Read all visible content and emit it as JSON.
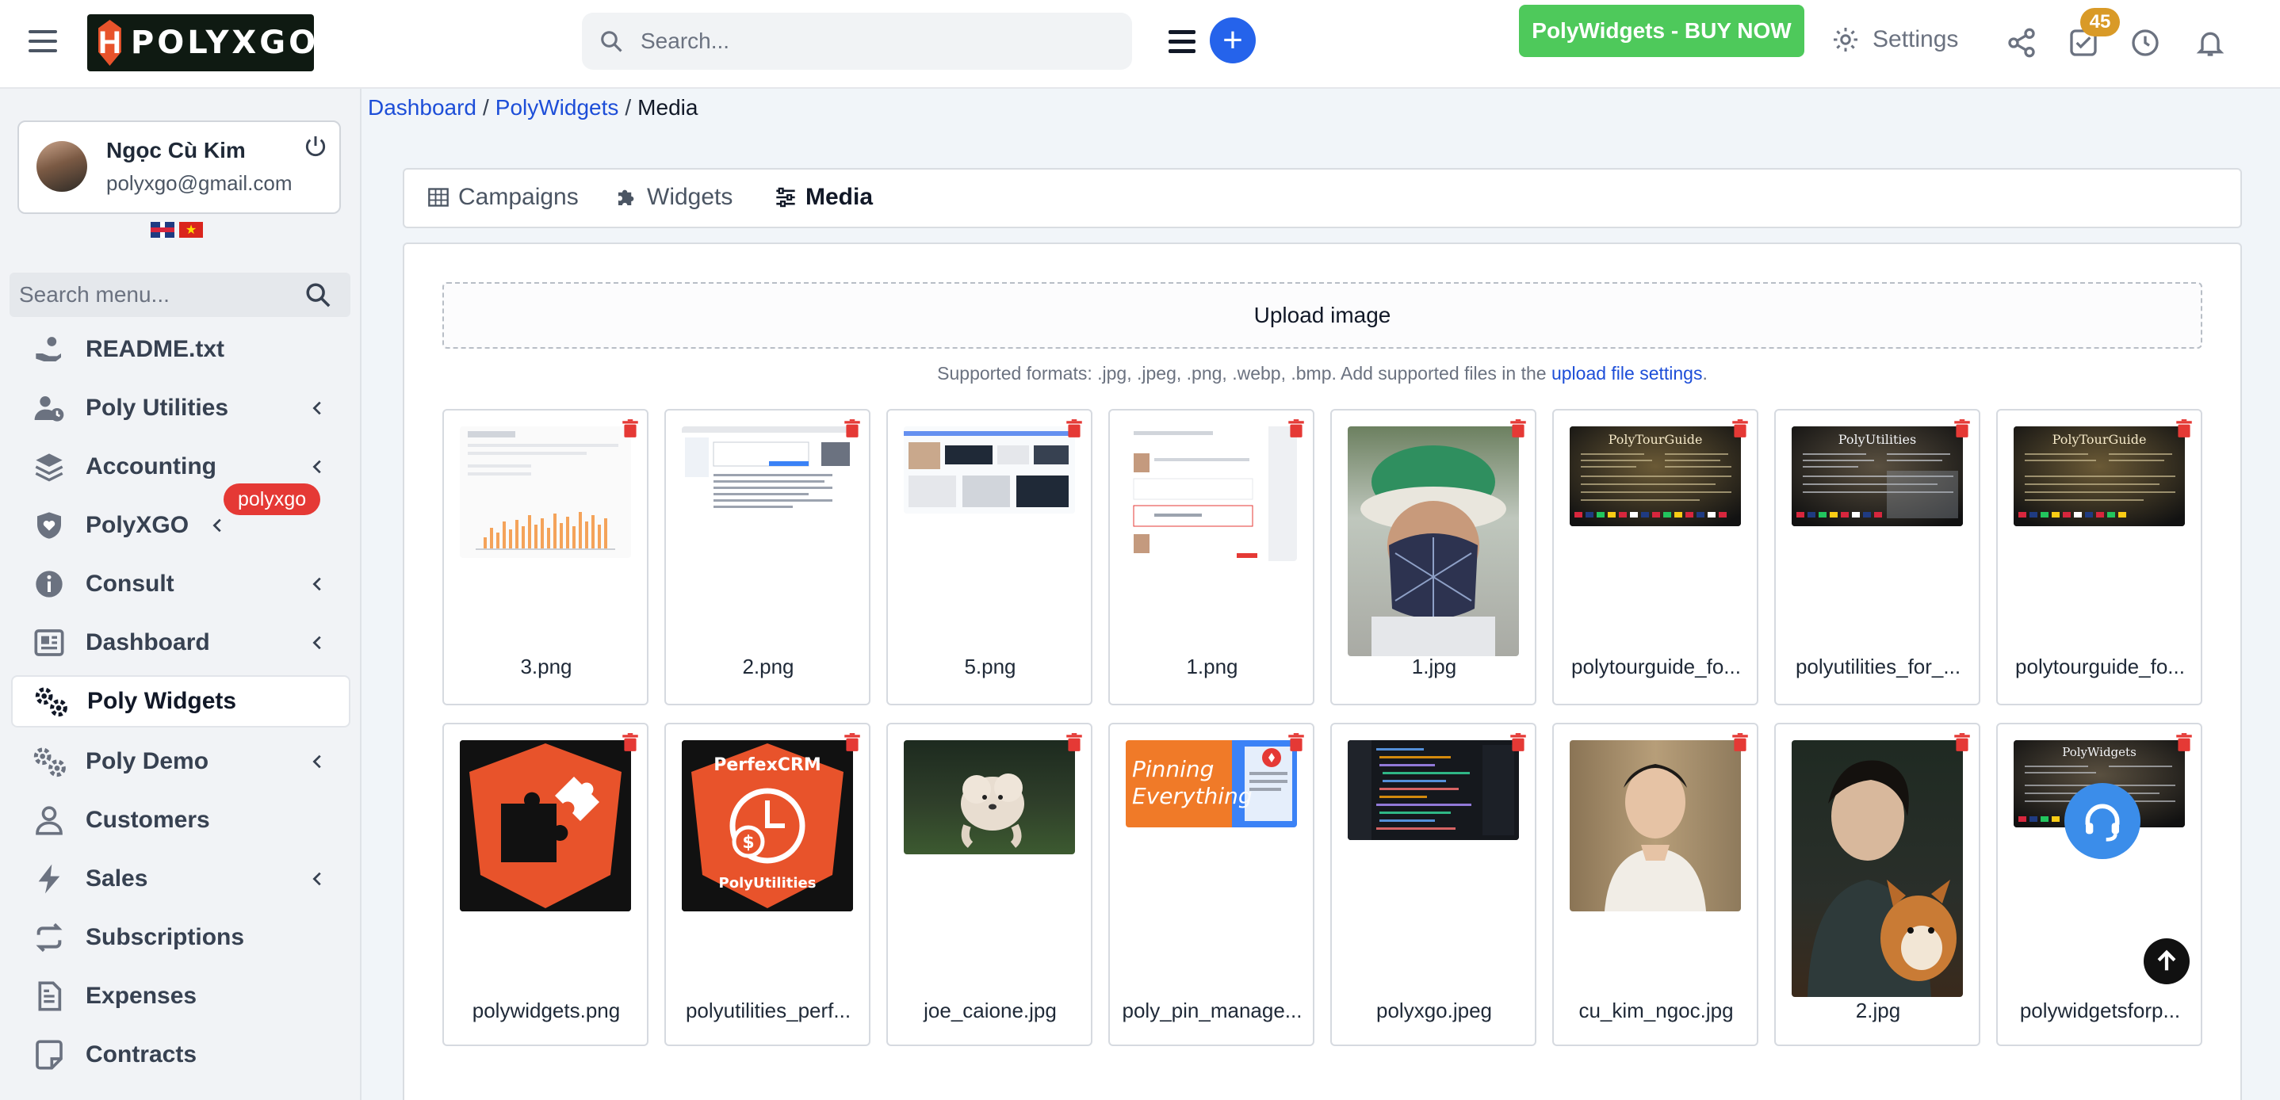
{
  "header": {
    "logo_letter": "H",
    "logo_text": "POLYXGO",
    "search_placeholder": "Search...",
    "buy_label": "PolyWidgets - BUY NOW",
    "settings_label": "Settings",
    "task_badge": "45"
  },
  "profile": {
    "name": "Ngọc Cù Kim",
    "email": "polyxgo@gmail.com"
  },
  "sidebar": {
    "search_placeholder": "Search menu...",
    "badge": "polyxgo",
    "items": [
      {
        "label": "README.txt",
        "icon": "hand-holding-icon"
      },
      {
        "label": "Poly Utilities",
        "icon": "user-clock-icon"
      },
      {
        "label": "Accounting",
        "icon": "layers-icon"
      },
      {
        "label": "PolyXGO",
        "icon": "shield-heart-icon"
      },
      {
        "label": "Consult",
        "icon": "info-icon"
      },
      {
        "label": "Dashboard",
        "icon": "dashboard-icon"
      },
      {
        "label": "Poly Widgets",
        "icon": "gears-icon"
      },
      {
        "label": "Poly Demo",
        "icon": "gears-icon"
      },
      {
        "label": "Customers",
        "icon": "user-icon"
      },
      {
        "label": "Sales",
        "icon": "bolt-icon"
      },
      {
        "label": "Subscriptions",
        "icon": "repeat-icon"
      },
      {
        "label": "Expenses",
        "icon": "file-lines-icon"
      },
      {
        "label": "Contracts",
        "icon": "note-icon"
      }
    ]
  },
  "breadcrumb": {
    "items": [
      "Dashboard",
      "PolyWidgets",
      "Media"
    ]
  },
  "tabs": [
    {
      "label": "Campaigns"
    },
    {
      "label": "Widgets"
    },
    {
      "label": "Media"
    }
  ],
  "media": {
    "upload_label": "Upload image",
    "formats_text": "Supported formats: .jpg, .jpeg, .png, .webp, .bmp. Add supported files in the ",
    "formats_link": "upload file settings",
    "formats_end": ".",
    "files": [
      {
        "name": "3.png"
      },
      {
        "name": "2.png"
      },
      {
        "name": "5.png"
      },
      {
        "name": "1.png"
      },
      {
        "name": "1.jpg"
      },
      {
        "name": "polytourguide_fo..."
      },
      {
        "name": "polyutilities_for_..."
      },
      {
        "name": "polytourguide_fo..."
      },
      {
        "name": "polywidgets.png"
      },
      {
        "name": "polyutilities_perf..."
      },
      {
        "name": "joe_caione.jpg"
      },
      {
        "name": "poly_pin_manage..."
      },
      {
        "name": "polyxgo.jpeg"
      },
      {
        "name": "cu_kim_ngoc.jpg"
      },
      {
        "name": "2.jpg"
      },
      {
        "name": "polywidgetsforp..."
      }
    ],
    "thumb_texts": {
      "perfexcrm": "PerfexCRM",
      "polyutilities": "PolyUtilities",
      "pinning_1": "Pinning",
      "pinning_2": "Everything",
      "polytourguide": "PolyTourGuide",
      "polyutilities_dark": "PolyUtilities",
      "polywidgets_dark": "PolyWidgets"
    }
  },
  "colors": {
    "accent": "#2563eb",
    "buy": "#4ec95b",
    "danger": "#e53935",
    "link": "#1d4ed8"
  }
}
